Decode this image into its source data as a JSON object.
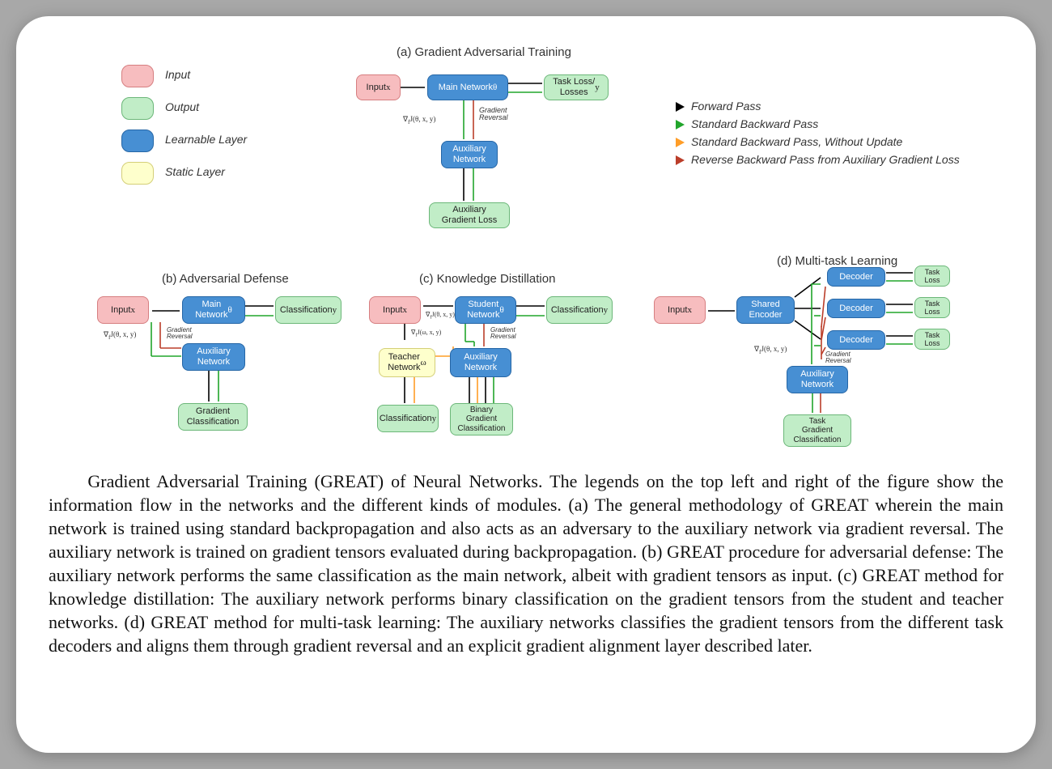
{
  "legendLeft": {
    "input": "Input",
    "output": "Output",
    "learnable": "Learnable Layer",
    "static": "Static Layer"
  },
  "legendRight": {
    "forward": "Forward Pass",
    "stdBack": "Standard Backward Pass",
    "stdBackNoUpdate": "Standard Backward Pass, Without Update",
    "revBack": "Reverse Backward Pass from Auxiliary Gradient Loss"
  },
  "titles": {
    "a": "(a) Gradient Adversarial Training",
    "b": "(b) Adversarial Defense",
    "c": "(c) Knowledge Distillation",
    "d": "(d) Multi-task Learning"
  },
  "nodes": {
    "inputX": "Input\nx",
    "inputX_html": "Input<br><span class='math'>x</span>",
    "mainNetworkTheta": "Main Network<br><span class='math'>θ</span>",
    "mainNetworkThetaOne": "Main<br>Network <span class='math'>θ</span>",
    "studentNetworkTheta": "Student<br>Network <span class='math'>θ</span>",
    "teacherNetworkOmega": "Teacher<br>Network <span class='math'>ω</span>",
    "sharedEncoder": "Shared<br>Encoder",
    "decoder": "Decoder",
    "auxNetwork": "Auxiliary<br>Network",
    "taskLossY": "Task Loss/<br>Losses <span class='math'>y</span>",
    "classificationY": "Classification<br><span class='math'>y</span>",
    "auxGradLoss": "Auxiliary<br>Gradient Loss",
    "gradClassification": "Gradient<br>Classification",
    "binaryGradClassification": "Binary<br>Gradient<br>Classification",
    "taskGradClassification": "Task<br>Gradient<br>Classification",
    "taskLoss": "Task<br>Loss"
  },
  "annot": {
    "gradRev": "Gradient<br>Reversal",
    "gradJ": "∇<sub>f</sub>J(θ, x, y)",
    "gradJw": "∇<sub>f</sub>J(ω, x, y)"
  },
  "caption": "Gradient Adversarial Training (GREAT) of Neural Networks. The legends on the top left and right of the figure show the information flow in the networks and the different kinds of modules. (a) The general methodology of GREAT wherein the main network is trained using standard backpropagation and also acts as an adversary to the auxiliary network via gradient reversal. The auxiliary network is trained on gradient tensors evaluated during backpropagation. (b) GREAT procedure for adversarial defense: The auxiliary network performs the same classification as the main network, albeit with gradient tensors as input. (c) GREAT method for knowledge distillation: The auxiliary network performs binary classification on the gradient tensors from the student and teacher networks. (d) GREAT method for multi-task learning: The auxiliary networks classifies the gradient tensors from the different task decoders and aligns them through gradient reversal and an explicit gradient alignment layer described later."
}
